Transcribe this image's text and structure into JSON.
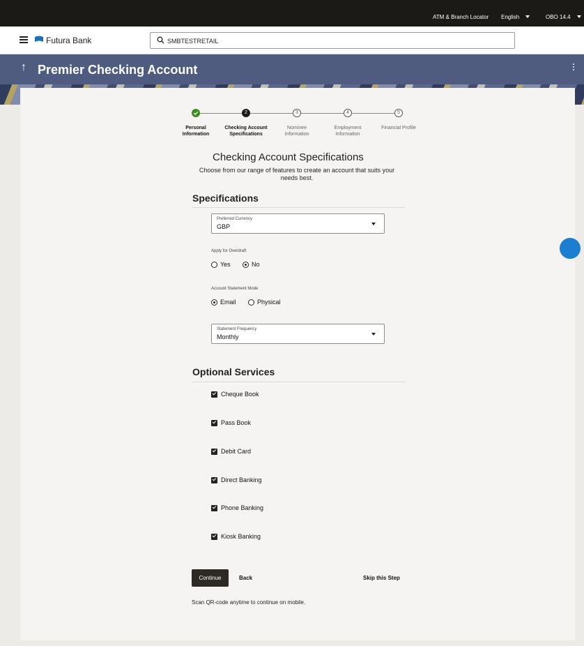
{
  "topbar": {
    "locator": "ATM & Branch Locator",
    "language": "English",
    "user": "OBO 14.4"
  },
  "appbar": {
    "brand": "Futura Bank",
    "search_value": "SMBTESTRETAIL"
  },
  "banner": {
    "title": "Premier Checking Account"
  },
  "stepper": {
    "steps": [
      {
        "number": "1",
        "label_line1": "Personal",
        "label_line2": "Information",
        "state": "done"
      },
      {
        "number": "2",
        "label_line1": "Checking Account",
        "label_line2": "Specifications",
        "state": "active"
      },
      {
        "number": "3",
        "label_line1": "Nominee",
        "label_line2": "Information",
        "state": "pending"
      },
      {
        "number": "4",
        "label_line1": "Employment",
        "label_line2": "Information",
        "state": "pending"
      },
      {
        "number": "5",
        "label_line1": "Financial Profile",
        "label_line2": "",
        "state": "pending"
      }
    ]
  },
  "heading": {
    "title": "Checking Account Specifications",
    "subtitle": "Choose from our range of features to create an account that suits your needs best."
  },
  "specifications": {
    "title": "Specifications",
    "currency": {
      "label": "Preferred Currency",
      "value": "GBP"
    },
    "overdraft": {
      "label": "Apply for Overdraft",
      "options": [
        "Yes",
        "No"
      ],
      "selected": "No"
    },
    "statement_mode": {
      "label": "Account Statement Mode",
      "options": [
        "Email",
        "Physical"
      ],
      "selected": "Email"
    },
    "frequency": {
      "label": "Statement Frequency",
      "value": "Monthly"
    }
  },
  "optional_services": {
    "title": "Optional Services",
    "items": [
      "Cheque Book",
      "Pass Book",
      "Debit Card",
      "Direct Banking",
      "Phone Banking",
      "Kiosk Banking"
    ]
  },
  "actions": {
    "continue": "Continue",
    "back": "Back",
    "skip": "Skip this Step"
  },
  "qr_note": "Scan QR-code anytime to continue on mobile.",
  "colors": {
    "topbar": "#1b1a17",
    "banner": "#4f5c7f",
    "done": "#3e8e1e",
    "primary_button": "#2d2a25",
    "fab": "#1b7ed1"
  }
}
